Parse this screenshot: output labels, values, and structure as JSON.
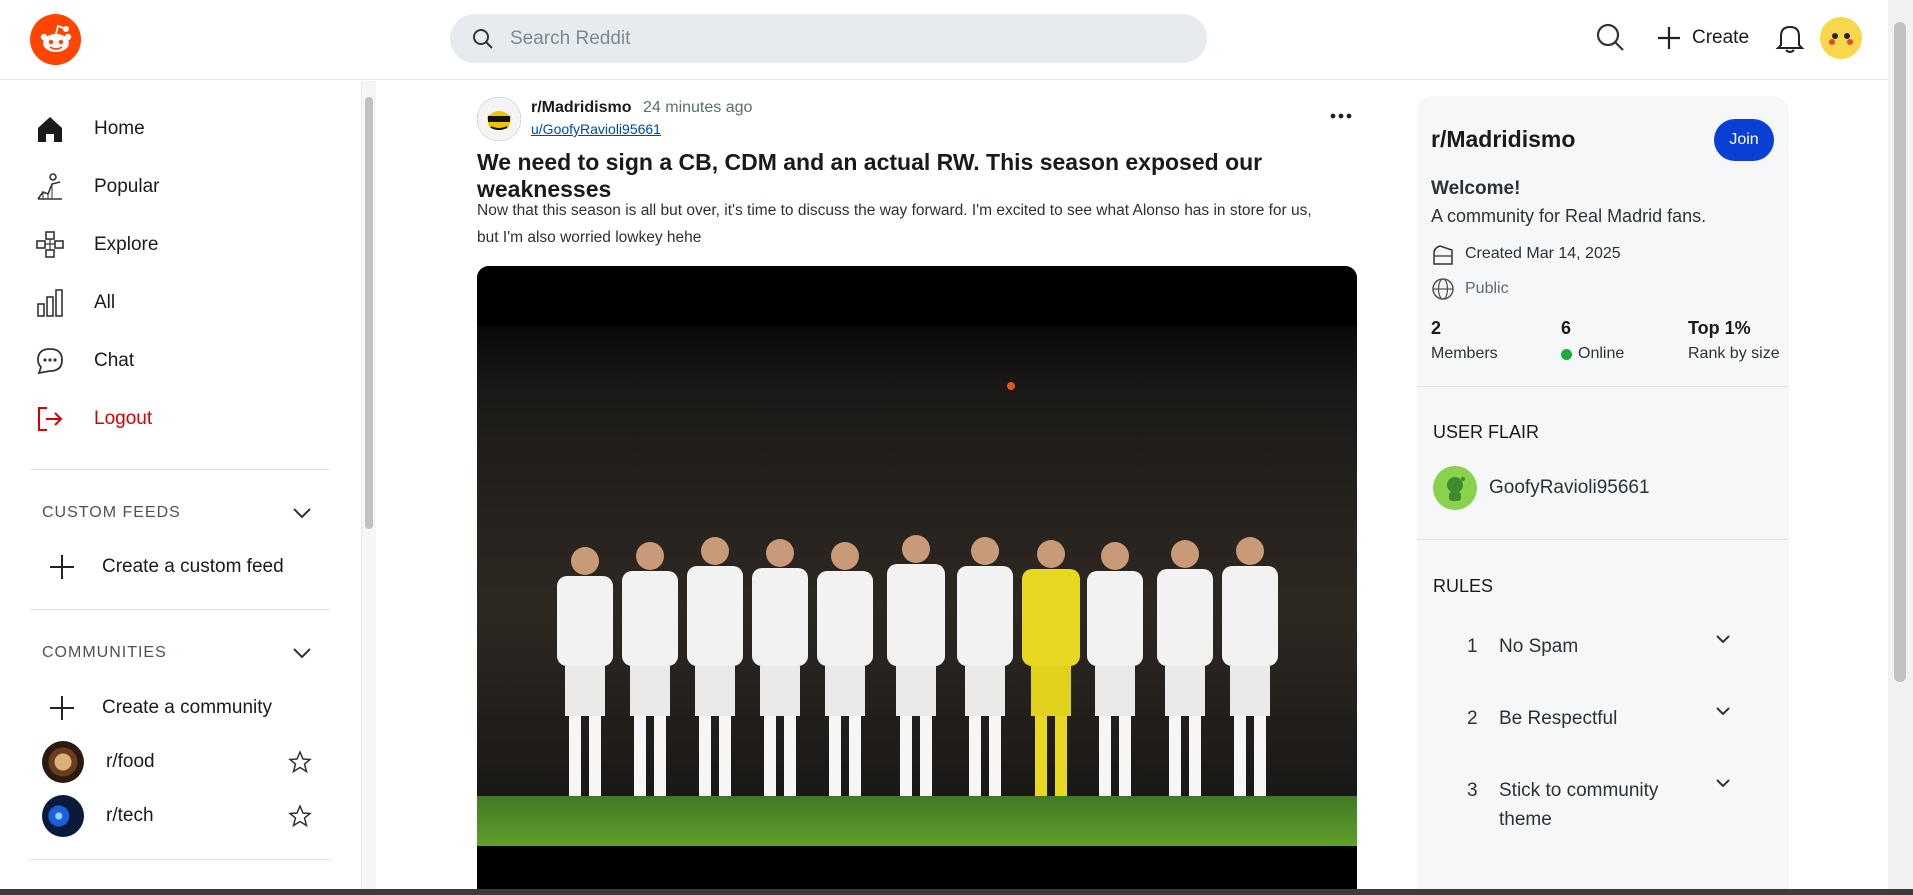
{
  "header": {
    "search_placeholder": "Search Reddit",
    "create_label": "Create"
  },
  "sidebar": {
    "nav": [
      {
        "label": "Home",
        "icon": "home-icon"
      },
      {
        "label": "Popular",
        "icon": "popular-icon"
      },
      {
        "label": "Explore",
        "icon": "explore-icon"
      },
      {
        "label": "All",
        "icon": "all-icon"
      },
      {
        "label": "Chat",
        "icon": "chat-icon"
      },
      {
        "label": "Logout",
        "icon": "logout-icon"
      }
    ],
    "custom_feeds": {
      "title": "CUSTOM FEEDS",
      "create_label": "Create a custom feed"
    },
    "communities": {
      "title": "COMMUNITIES",
      "create_label": "Create a community",
      "items": [
        {
          "name": "r/food"
        },
        {
          "name": "r/tech"
        }
      ]
    }
  },
  "post": {
    "subreddit": "r/Madridismo",
    "time": "24 minutes ago",
    "author": "u/GoofyRavioli95661",
    "title": "We need to sign a CB, CDM and an actual RW. This season exposed our weaknesses",
    "body_line1": "Now that this season is all but over, it's time to discuss the way forward. I'm excited to see what Alonso has in store for us,",
    "body_line2": "but I'm also worried lowkey hehe"
  },
  "community_panel": {
    "name": "r/Madridismo",
    "join_label": "Join",
    "welcome": "Welcome!",
    "description": "A community for Real Madrid fans.",
    "created": "Created Mar 14, 2025",
    "visibility": "Public",
    "stats": [
      {
        "value": "2",
        "label": "Members"
      },
      {
        "value": "6",
        "label": "Online"
      },
      {
        "value": "Top 1%",
        "label": "Rank by size"
      }
    ],
    "user_flair_title": "USER FLAIR",
    "user_flair_name": "GoofyRavioli95661",
    "rules_title": "RULES",
    "rules": [
      {
        "num": "1",
        "text": "No Spam"
      },
      {
        "num": "2",
        "text": "Be Respectful"
      },
      {
        "num": "3",
        "text": "Stick to community theme"
      }
    ]
  },
  "colors": {
    "brand": "#ff4500",
    "join": "#0a3fd6",
    "logout": "#d60000",
    "online": "#1aab3a"
  }
}
